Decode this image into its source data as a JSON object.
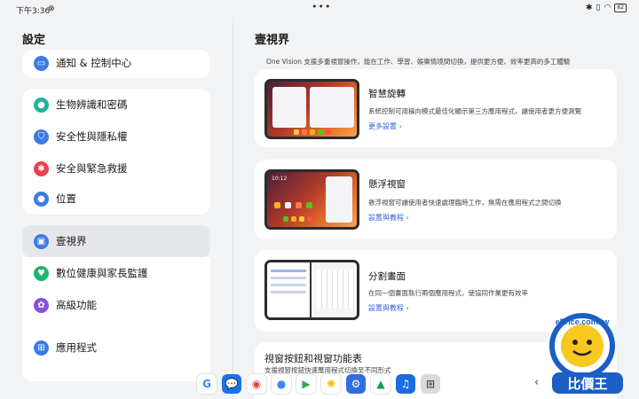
{
  "status": {
    "time": "下午3:36",
    "notif_icon": "⊗",
    "more": "•••",
    "battery": "62"
  },
  "left": {
    "title": "設定",
    "items": [
      {
        "label": "通知 & 控制中心",
        "color": "#3d7be6",
        "glyph": "▭"
      },
      {
        "label": "生物辨識和密碼",
        "color": "#20b39c",
        "glyph": "🔒"
      },
      {
        "label": "安全性與隱私權",
        "color": "#3d7be6",
        "glyph": "⛉"
      },
      {
        "label": "安全與緊急救援",
        "color": "#e8414f",
        "glyph": "✱"
      },
      {
        "label": "位置",
        "color": "#3d7be6",
        "glyph": "⌖"
      },
      {
        "label": "壹視界",
        "color": "#3d7be6",
        "glyph": "▣"
      },
      {
        "label": "數位健康與家長監護",
        "color": "#20b36a",
        "glyph": "♥"
      },
      {
        "label": "高級功能",
        "color": "#8a4fe0",
        "glyph": "✿"
      },
      {
        "label": "應用程式",
        "color": "#3d7be6",
        "glyph": "⊞"
      }
    ]
  },
  "right": {
    "title": "壹視界",
    "desc": "One Vision 支援多重視窗操作，能在工作、學習、娛樂情境間切換，提供更方便、效率更高的多工體驗",
    "cards": [
      {
        "title": "智慧旋轉",
        "desc": "系統控制可用橫向模式最佳化顯示第三方應用程式，讓使用者更方便測覽",
        "link": "更多設置"
      },
      {
        "title": "懸浮視窗",
        "desc": "懸浮視窗可讓使用者快速處理臨時工作，無需在應用程式之間切換",
        "link": "設置與教程"
      },
      {
        "title": "分割畫面",
        "desc": "在同一個畫面執行兩個應用程式，使協同作業更有效率",
        "link": "設置與教程"
      },
      {
        "title": "視窗按鈕和視窗功能表",
        "desc": "支援視窗按鈕快速應用程式切換至不同形式",
        "link": ""
      }
    ],
    "float_time": "10:12"
  },
  "dock": {
    "apps": [
      {
        "name": "google",
        "glyph": "G",
        "bg": "#ffffff",
        "fg": "#4285f4"
      },
      {
        "name": "messages",
        "glyph": "💬",
        "bg": "#1a73e8",
        "fg": "#fff"
      },
      {
        "name": "chrome",
        "glyph": "◉",
        "bg": "#ffffff",
        "fg": "#db4437"
      },
      {
        "name": "assistant",
        "glyph": "●",
        "bg": "#ffffff",
        "fg": "#4285f4"
      },
      {
        "name": "play-store",
        "glyph": "▶",
        "bg": "#ffffff",
        "fg": "#34a853"
      },
      {
        "name": "photos",
        "glyph": "✺",
        "bg": "#ffffff",
        "fg": "#fbbc05"
      },
      {
        "name": "settings",
        "glyph": "⚙",
        "bg": "#2f6de0",
        "fg": "#fff"
      },
      {
        "name": "drive",
        "glyph": "▲",
        "bg": "#ffffff",
        "fg": "#0f9d58"
      },
      {
        "name": "music",
        "glyph": "♫",
        "bg": "#1d6be0",
        "fg": "#fff"
      },
      {
        "name": "app-grid",
        "glyph": "⊞",
        "bg": "#d9dadc",
        "fg": "#555"
      }
    ],
    "back": "‹"
  },
  "watermark": {
    "line1": "ePrice.com.tw",
    "line2": "比價王"
  }
}
